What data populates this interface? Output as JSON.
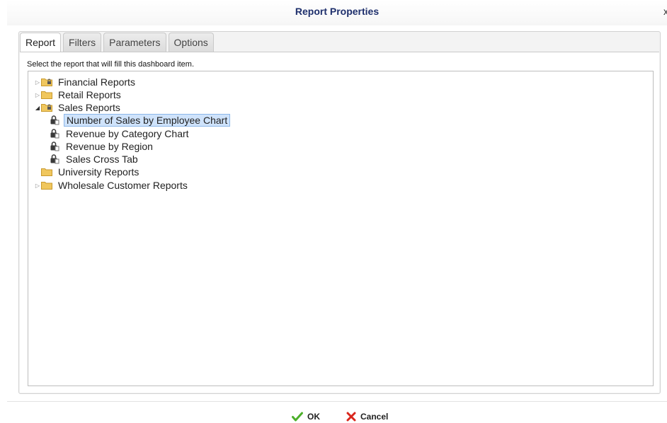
{
  "dialog": {
    "title": "Report Properties",
    "close_glyph": "x"
  },
  "tabs": [
    {
      "label": "Report",
      "active": true
    },
    {
      "label": "Filters",
      "active": false
    },
    {
      "label": "Parameters",
      "active": false
    },
    {
      "label": "Options",
      "active": false
    }
  ],
  "report_tab": {
    "instructions": "Select the report that will fill this dashboard item."
  },
  "tree": {
    "items": [
      {
        "label": "Financial Reports",
        "type": "folder",
        "expander": "collapsed",
        "locked": true
      },
      {
        "label": "Retail Reports",
        "type": "folder",
        "expander": "collapsed",
        "locked": false
      },
      {
        "label": "Sales Reports",
        "type": "folder",
        "expander": "expanded",
        "locked": true
      },
      {
        "label": "Number of Sales by Employee Chart",
        "type": "report",
        "selected": true
      },
      {
        "label": "Revenue by Category Chart",
        "type": "report"
      },
      {
        "label": "Revenue by Region",
        "type": "report"
      },
      {
        "label": "Sales Cross Tab",
        "type": "report"
      },
      {
        "label": "University Reports",
        "type": "folder",
        "expander": "none",
        "locked": false
      },
      {
        "label": "Wholesale Customer Reports",
        "type": "folder",
        "expander": "collapsed",
        "locked": false
      }
    ]
  },
  "buttons": {
    "ok_label": "OK",
    "cancel_label": "Cancel"
  },
  "colors": {
    "title": "#1e2f6c",
    "folder": "#f0c75e",
    "selection": "#cfe3fb",
    "ok_icon": "#4caf2a",
    "cancel_icon": "#d9261c"
  },
  "icons": {
    "close": "close-icon",
    "folder": "folder-icon",
    "report": "locked-report-icon",
    "ok": "check-icon",
    "cancel": "x-icon"
  }
}
